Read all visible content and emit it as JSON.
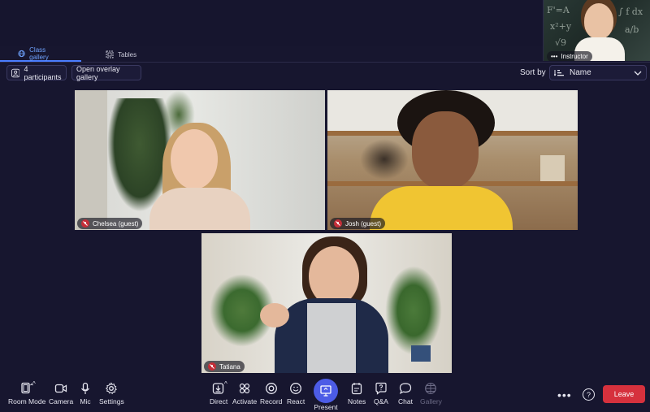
{
  "instructor": {
    "label": "Instructor",
    "chalk": [
      "F'=A",
      "x²+y",
      "∫ f dx",
      "a/b",
      "√9"
    ]
  },
  "tabs": [
    {
      "label": "Class gallery",
      "icon": "grid-globe-icon",
      "active": true
    },
    {
      "label": "Tables",
      "icon": "tables-icon",
      "active": false
    }
  ],
  "toolbar": {
    "participants_label": "4 participants",
    "overlay_label": "Open overlay gallery",
    "sort_label": "Sort by",
    "sort_value": "Name"
  },
  "tiles": {
    "chelsea": {
      "name": "Chelsea (guest)"
    },
    "josh": {
      "name": "Josh (guest)"
    },
    "tatiana": {
      "name": "Tatiana"
    }
  },
  "controls": {
    "room_mode": "Room Mode",
    "camera": "Camera",
    "mic": "Mic",
    "settings": "Settings",
    "direct": "Direct",
    "activate": "Activate",
    "record": "Record",
    "react": "React",
    "present": "Present",
    "notes": "Notes",
    "qa": "Q&A",
    "chat": "Chat",
    "gallery": "Gallery",
    "leave": "Leave"
  },
  "colors": {
    "accent": "#4c5ce6",
    "leave": "#d6313d",
    "mute": "#c52d37",
    "active_tab": "#6fa3ff"
  }
}
